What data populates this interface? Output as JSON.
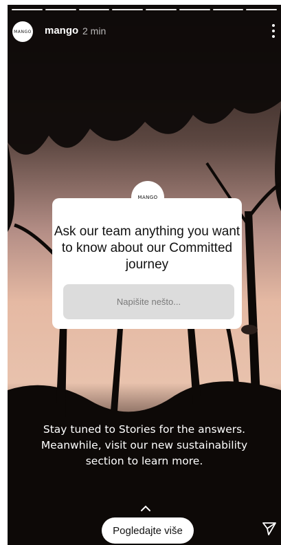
{
  "story": {
    "progress_segments": 8,
    "author": "mango",
    "avatar_text": "MANGO",
    "time_ago": "2 min"
  },
  "question_sticker": {
    "logo_text": "MANGO",
    "question": "Ask our team anything you want to know about our Committed journey",
    "input_placeholder": "Napišite nešto..."
  },
  "caption": {
    "line1": "Stay tuned to Stories for the answers.",
    "line2": "Meanwhile, visit our new sustainability",
    "line3": "section to learn more."
  },
  "footer": {
    "see_more_label": "Pogledajte više",
    "swipe_up_icon": "chevron-up-icon",
    "send_icon": "send-icon"
  },
  "colors": {
    "sky": "#c9a49a",
    "sea": "#e9c3ad",
    "foliage": "#0e0a08"
  }
}
